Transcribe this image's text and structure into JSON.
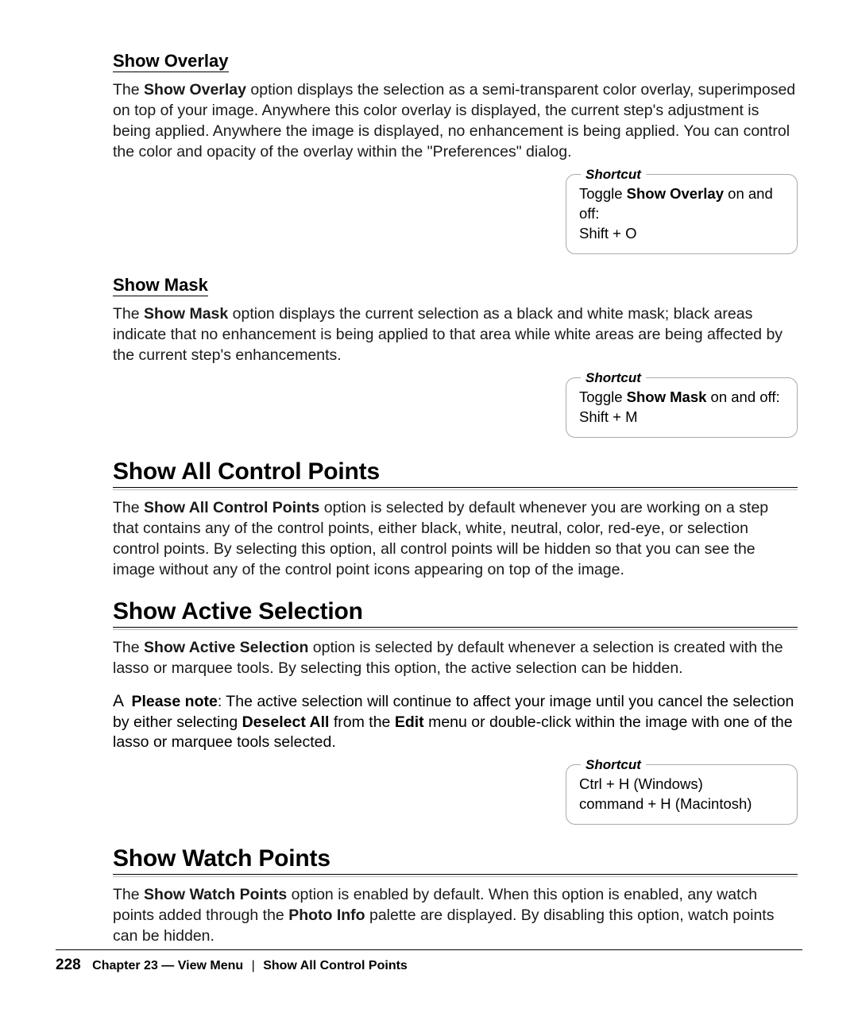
{
  "sections": {
    "show_overlay": {
      "heading": "Show Overlay",
      "bold_term": "Show Overlay",
      "para_before": "The ",
      "para_after": " option displays the selection as a semi-transparent color overlay, superimposed on top of your image. Anywhere this color overlay is displayed, the current step's adjustment is being applied. Anywhere the image is displayed, no enhancement is being applied. You can control the color and opacity of the overlay within the \"Preferences\" dialog.",
      "shortcut": {
        "legend": "Shortcut",
        "line1a": "Toggle ",
        "line1b": "Show Overlay",
        "line1c": " on and off:",
        "line2": "Shift + O"
      }
    },
    "show_mask": {
      "heading": "Show Mask",
      "bold_term": "Show Mask",
      "para_before": "The ",
      "para_after": " option displays the current selection as a black and white mask; black areas indicate that no enhancement is being applied to that area while white areas are being affected by the current step's enhancements.",
      "shortcut": {
        "legend": "Shortcut",
        "line1a": "Toggle ",
        "line1b": "Show Mask",
        "line1c": " on and off:",
        "line2": "Shift + M"
      }
    },
    "show_all_cp": {
      "heading": "Show All Control Points",
      "bold_term": "Show All Control Points",
      "para_before": "The ",
      "para_after": " option is selected by default whenever you are working on a step that contains any of the control points, either black, white, neutral, color, red-eye, or selection control points. By selecting this option, all control points will be hidden so that you can see the image without any of the control point icons appearing on top of the image."
    },
    "show_active": {
      "heading": "Show Active Selection",
      "bold_term": "Show Active Selection",
      "para_before": "The ",
      "para_after": " option is selected by default whenever a selection is created with the lasso or marquee tools. By selecting this option, the active selection can be hidden.",
      "note": {
        "marker": "A",
        "label": "Please note",
        "text_before": ": The active selection will continue to affect your image until you cancel the selection by either selecting ",
        "bold1": "Deselect All",
        "text_mid": " from the ",
        "bold2": "Edit",
        "text_after": " menu or double-click within the image with one of the lasso or marquee tools selected."
      },
      "shortcut": {
        "legend": "Shortcut",
        "line1": "Ctrl + H (Windows)",
        "line2": "command + H (Macintosh)"
      }
    },
    "show_watch": {
      "heading": "Show Watch Points",
      "bold_term": "Show Watch Points",
      "para_before": "The ",
      "para_mid1": " option is enabled by default. When this option is enabled, any watch points added through the ",
      "bold2": "Photo Info",
      "para_after": " palette are displayed. By disabling this option, watch points can be hidden."
    }
  },
  "footer": {
    "page": "228",
    "chapter_label": "Chapter 23 — View Menu",
    "separator": "|",
    "topic": "Show All Control Points"
  }
}
